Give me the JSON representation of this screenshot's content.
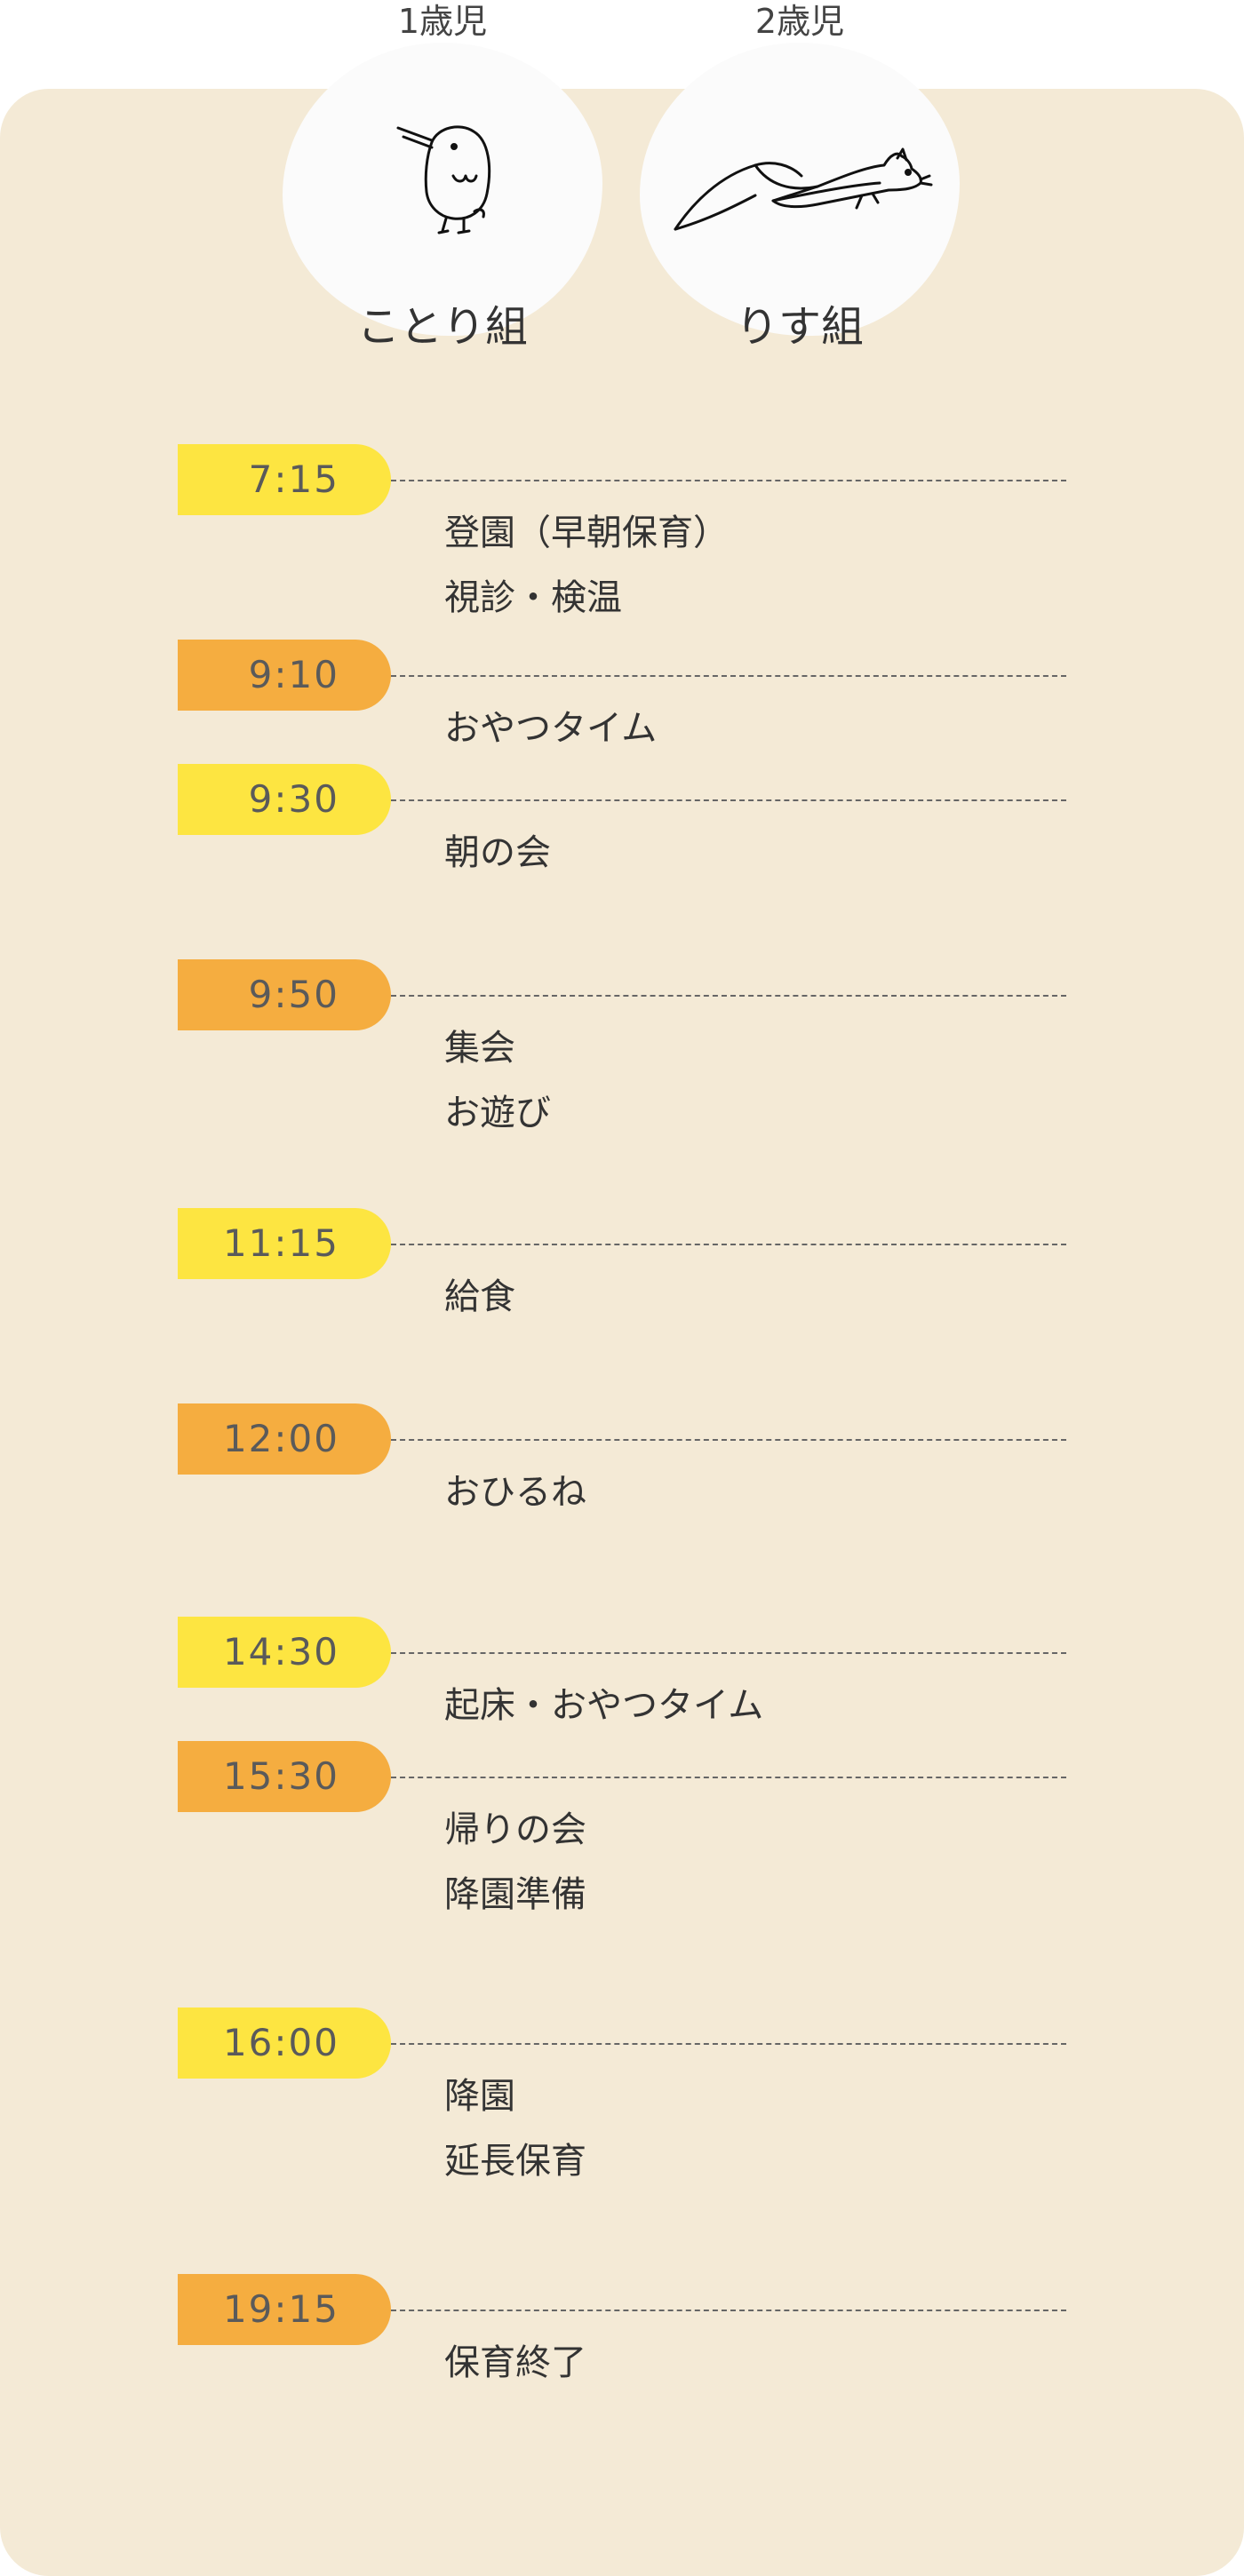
{
  "classes": [
    {
      "age": "1歳児",
      "name": "ことり組",
      "icon": "bird-icon"
    },
    {
      "age": "2歳児",
      "name": "りす組",
      "icon": "squirrel-icon"
    }
  ],
  "schedule": [
    {
      "time": "7:15",
      "color": "yellow",
      "activities": [
        "登園（早朝保育）",
        "視診・検温"
      ]
    },
    {
      "time": "9:10",
      "color": "orange",
      "activities": [
        "おやつタイム"
      ]
    },
    {
      "time": "9:30",
      "color": "yellow",
      "activities": [
        "朝の会"
      ]
    },
    {
      "time": "9:50",
      "color": "orange",
      "activities": [
        "集会",
        "お遊び"
      ]
    },
    {
      "time": "11:15",
      "color": "yellow",
      "activities": [
        "給食"
      ]
    },
    {
      "time": "12:00",
      "color": "orange",
      "activities": [
        "おひるね"
      ]
    },
    {
      "time": "14:30",
      "color": "yellow",
      "activities": [
        "起床・おやつタイム"
      ]
    },
    {
      "time": "15:30",
      "color": "orange",
      "activities": [
        "帰りの会",
        "降園準備"
      ]
    },
    {
      "time": "16:00",
      "color": "yellow",
      "activities": [
        "降園",
        "延長保育"
      ]
    },
    {
      "time": "19:15",
      "color": "orange",
      "activities": [
        "保育終了"
      ]
    }
  ],
  "colors": {
    "yellow": "#fde541",
    "orange": "#f5ad40",
    "background": "#f4ead6"
  }
}
